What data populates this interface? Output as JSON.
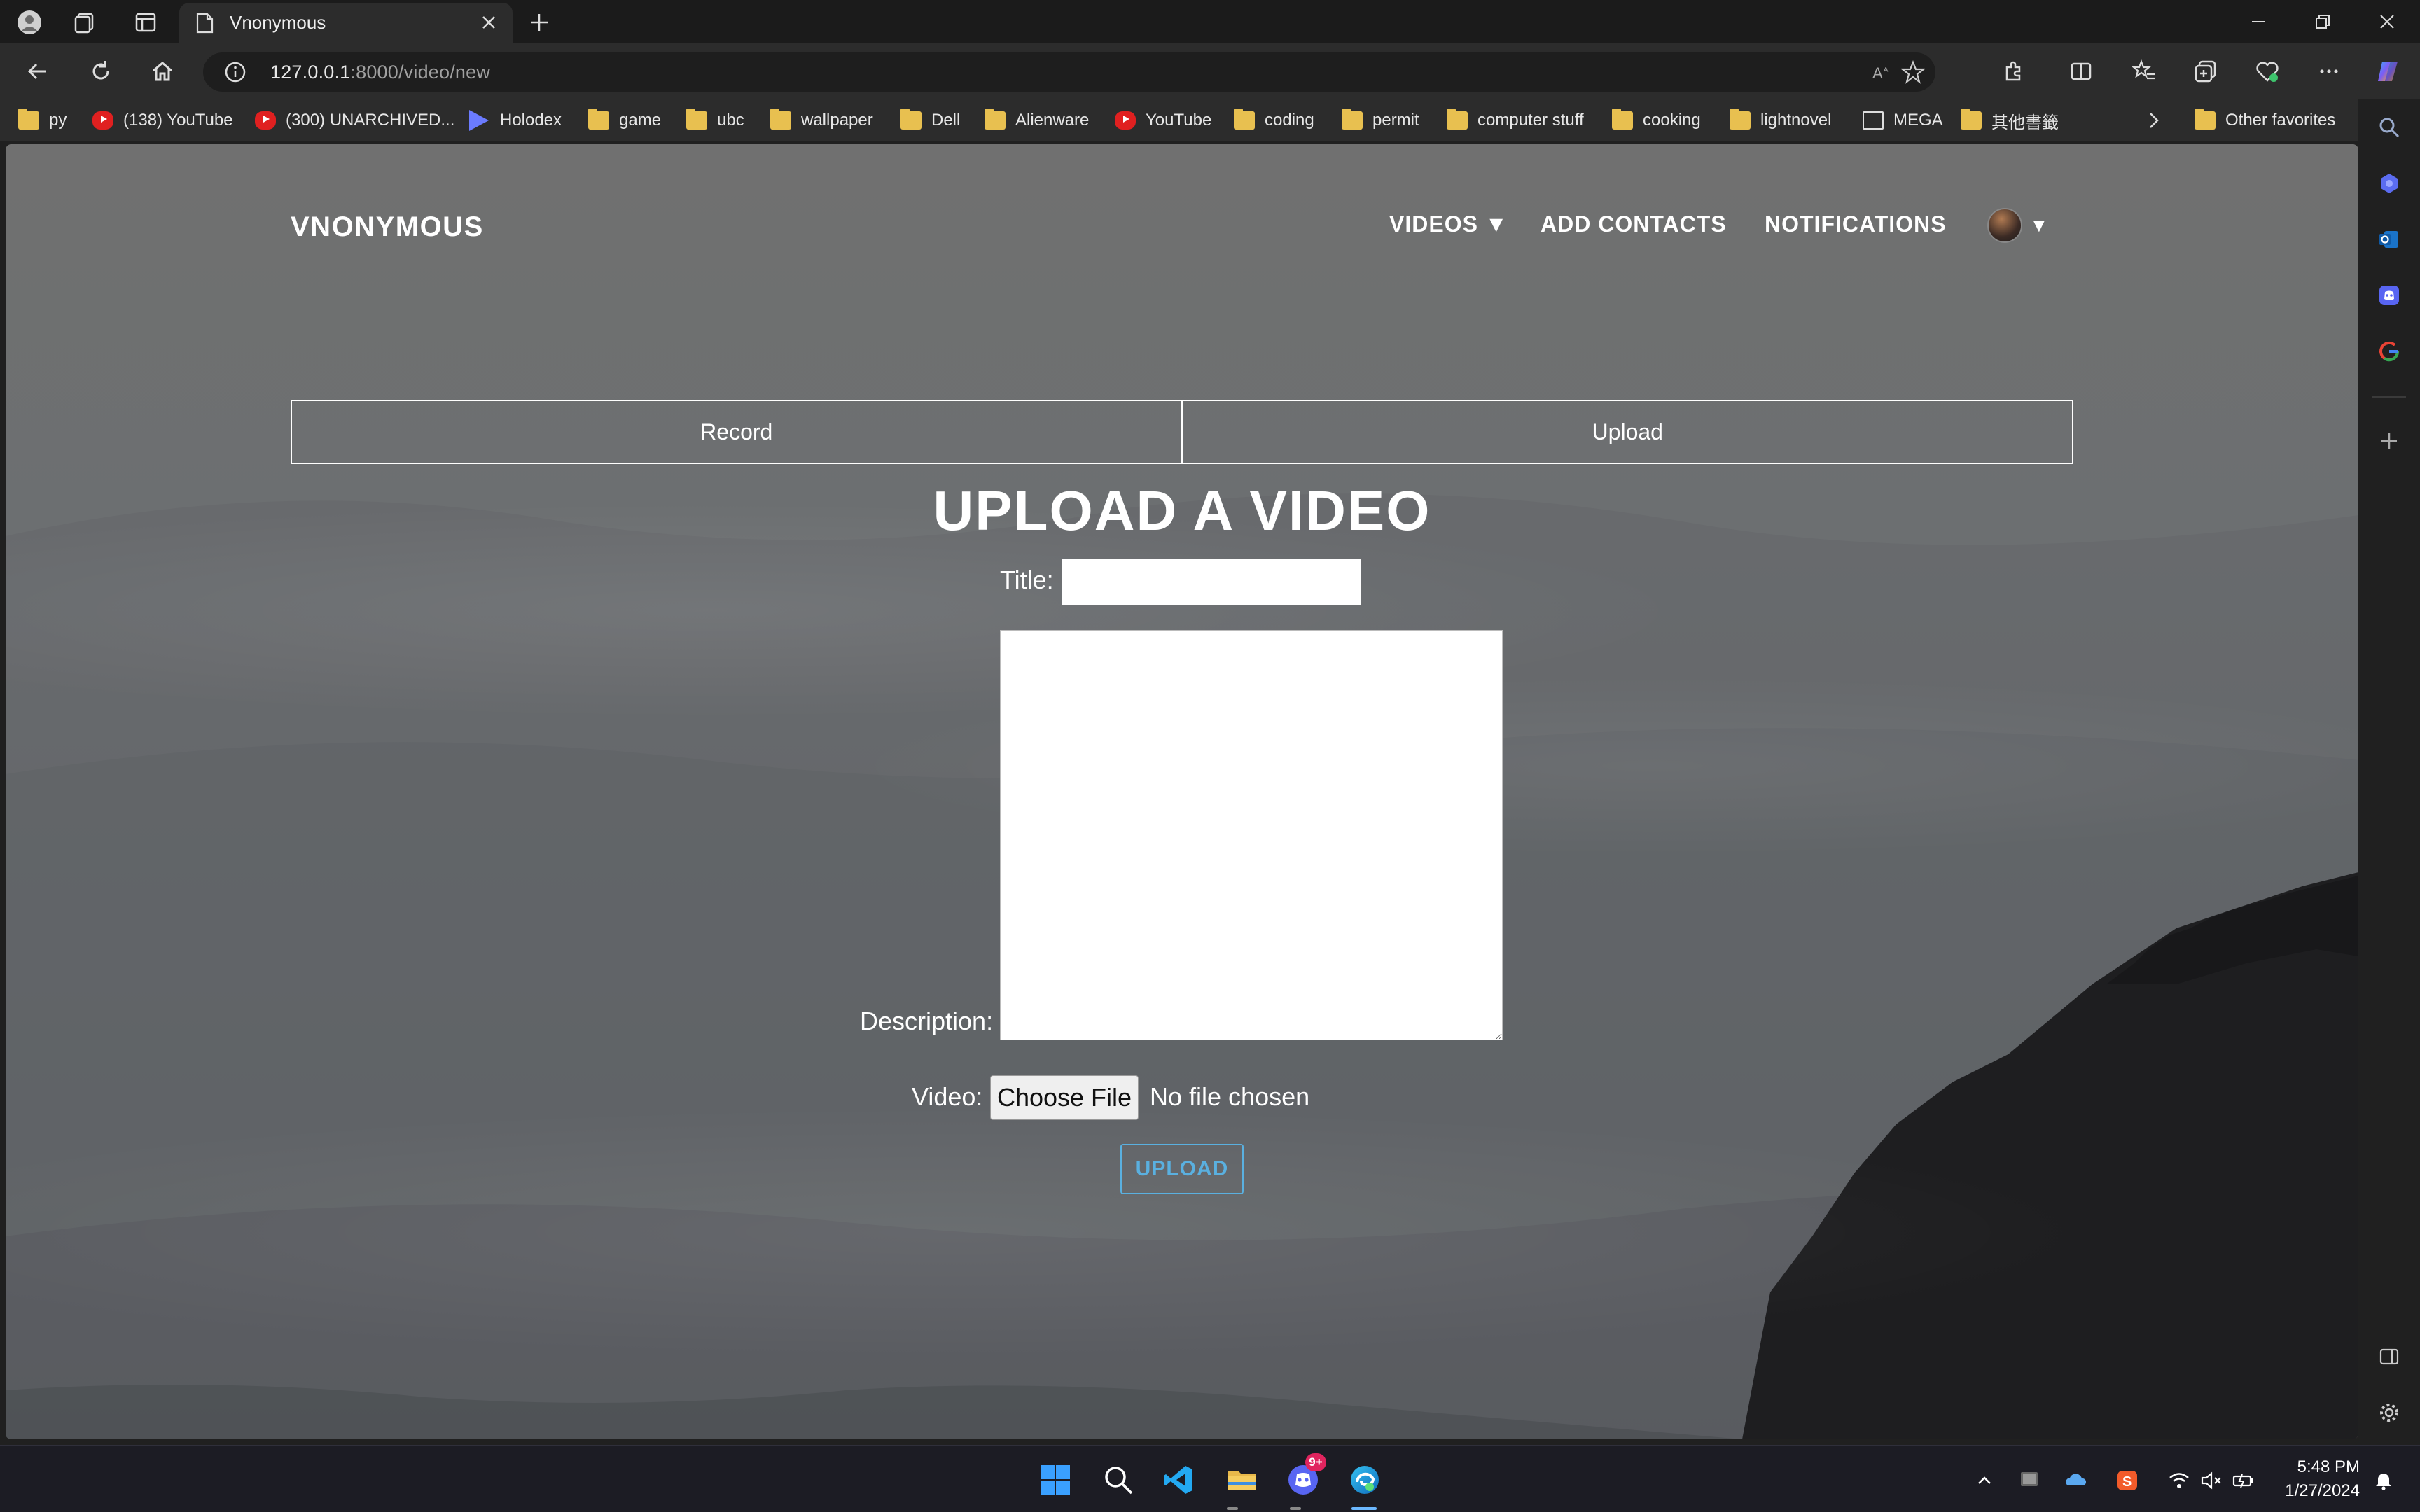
{
  "browser": {
    "tab_title": "Vnonymous",
    "url_host": "127.0.0.1",
    "url_rest": ":8000/video/new",
    "bookmarks": [
      {
        "label": "py",
        "icon": "folder-icon"
      },
      {
        "label": "(138) YouTube",
        "icon": "youtube-icon"
      },
      {
        "label": "(300) UNARCHIVED...",
        "icon": "youtube-icon"
      },
      {
        "label": "Holodex",
        "icon": "holodex-icon"
      },
      {
        "label": "game",
        "icon": "folder-icon"
      },
      {
        "label": "ubc",
        "icon": "folder-icon"
      },
      {
        "label": "wallpaper",
        "icon": "folder-icon"
      },
      {
        "label": "Dell",
        "icon": "folder-icon"
      },
      {
        "label": "Alienware",
        "icon": "folder-icon"
      },
      {
        "label": "YouTube",
        "icon": "youtube-icon"
      },
      {
        "label": "coding",
        "icon": "folder-icon"
      },
      {
        "label": "permit",
        "icon": "folder-icon"
      },
      {
        "label": "computer stuff",
        "icon": "folder-icon"
      },
      {
        "label": "cooking",
        "icon": "folder-icon"
      },
      {
        "label": "lightnovel",
        "icon": "folder-icon"
      },
      {
        "label": "MEGA",
        "icon": "document-icon"
      },
      {
        "label": "其他書籤",
        "icon": "folder-icon"
      }
    ],
    "other_favorites": "Other favorites"
  },
  "site": {
    "brand": "VNONYMOUS",
    "nav": {
      "videos": "VIDEOS ▼",
      "add_contacts": "ADD CONTACTS",
      "notifications": "NOTIFICATIONS",
      "avatar_caret": "▼"
    }
  },
  "page": {
    "tabs": {
      "record": "Record",
      "upload": "Upload"
    },
    "heading": "UPLOAD A VIDEO",
    "form": {
      "title_label": "Title:",
      "title_value": "",
      "description_label": "Description:",
      "description_value": "",
      "video_label": "Video:",
      "choose_file": "Choose File",
      "no_file": "No file chosen",
      "submit": "UPLOAD"
    }
  },
  "taskbar": {
    "time": "5:48 PM",
    "date": "1/27/2024",
    "discord_badge": "9+"
  }
}
